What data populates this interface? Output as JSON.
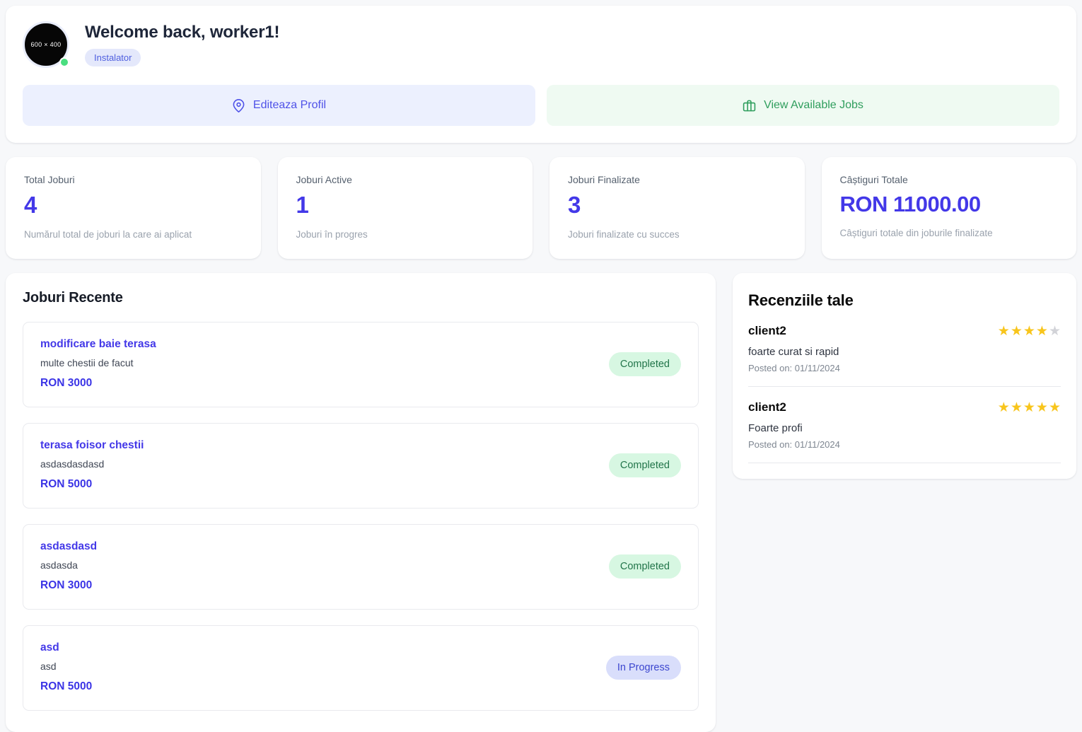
{
  "header": {
    "avatar_placeholder": "600 × 400",
    "avatar_status": "online",
    "greeting": "Welcome back, worker1!",
    "role_badge": "Instalator",
    "actions": [
      {
        "label": "Editeaza Profil",
        "icon": "map-pin-icon",
        "color": "#4f52e8"
      },
      {
        "label": "View Available Jobs",
        "icon": "briefcase-icon",
        "color": "#2f9e5d"
      }
    ]
  },
  "stats": [
    {
      "label": "Total Joburi",
      "value": "4",
      "desc": "Numărul total de joburi la care ai aplicat"
    },
    {
      "label": "Joburi Active",
      "value": "1",
      "desc": "Joburi în progres"
    },
    {
      "label": "Joburi Finalizate",
      "value": "3",
      "desc": "Joburi finalizate cu succes"
    },
    {
      "label": "Câștiguri Totale",
      "value": "RON 11000.00",
      "desc": "Câștiguri totale din joburile finalizate"
    }
  ],
  "jobs_section": {
    "title": "Joburi Recente",
    "items": [
      {
        "title": "modificare baie terasa",
        "desc": "multe chestii de facut",
        "price": "RON 3000",
        "status": "Completed",
        "status_kind": "completed"
      },
      {
        "title": "terasa foisor chestii",
        "desc": "asdasdasdasd",
        "price": "RON 5000",
        "status": "Completed",
        "status_kind": "completed"
      },
      {
        "title": "asdasdasd",
        "desc": "asdasda",
        "price": "RON 3000",
        "status": "Completed",
        "status_kind": "completed"
      },
      {
        "title": "asd",
        "desc": "asd",
        "price": "RON 5000",
        "status": "In Progress",
        "status_kind": "inprogress"
      }
    ]
  },
  "reviews_section": {
    "title": "Recenziile tale",
    "items": [
      {
        "author": "client2",
        "rating": 4,
        "max_rating": 5,
        "text": "foarte curat si rapid",
        "date": "Posted on: 01/11/2024"
      },
      {
        "author": "client2",
        "rating": 5,
        "max_rating": 5,
        "text": "Foarte profi",
        "date": "Posted on: 01/11/2024"
      }
    ]
  },
  "colors": {
    "page_background": "#f7f8fa",
    "accent_indigo": "#4338e8",
    "accent_green": "#2f9e5d",
    "star_filled": "#f8c51c",
    "star_empty": "#d2d3d8",
    "status_online": "#4ade80"
  }
}
